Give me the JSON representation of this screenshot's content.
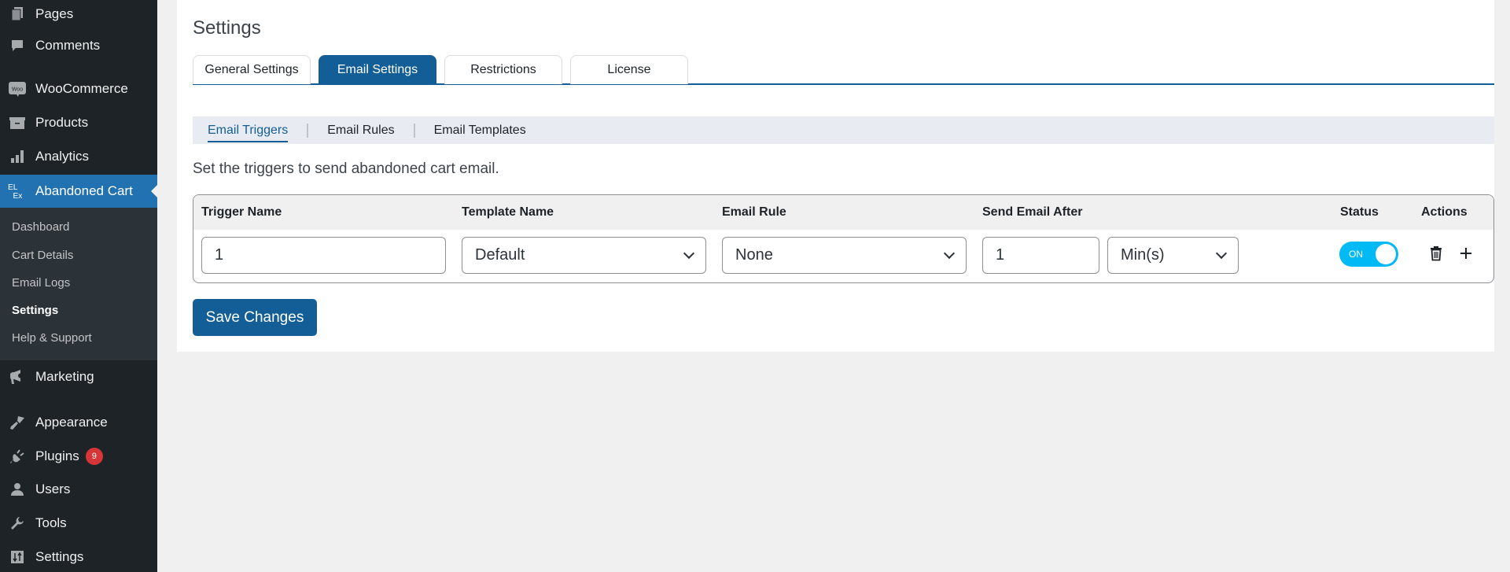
{
  "sidebar": {
    "items": [
      {
        "label": "Pages",
        "icon": "pages-icon"
      },
      {
        "label": "Comments",
        "icon": "comments-icon"
      },
      {
        "label": "WooCommerce",
        "icon": "woocommerce-icon",
        "icon_text": "Woo"
      },
      {
        "label": "Products",
        "icon": "products-icon"
      },
      {
        "label": "Analytics",
        "icon": "analytics-icon"
      },
      {
        "label": "Abandoned Cart",
        "icon": "elex-icon",
        "icon_text": "EL Ex",
        "active": true
      },
      {
        "label": "Marketing",
        "icon": "megaphone-icon"
      },
      {
        "label": "Appearance",
        "icon": "brush-icon"
      },
      {
        "label": "Plugins",
        "icon": "plugin-icon",
        "badge": "9"
      },
      {
        "label": "Users",
        "icon": "user-icon"
      },
      {
        "label": "Tools",
        "icon": "wrench-icon"
      },
      {
        "label": "Settings",
        "icon": "settings-icon"
      }
    ],
    "submenu": [
      {
        "label": "Dashboard"
      },
      {
        "label": "Cart Details"
      },
      {
        "label": "Email Logs"
      },
      {
        "label": "Settings",
        "current": true
      },
      {
        "label": "Help & Support"
      }
    ]
  },
  "page": {
    "title": "Settings",
    "tabs": [
      {
        "label": "General Settings"
      },
      {
        "label": "Email Settings",
        "active": true
      },
      {
        "label": "Restrictions"
      },
      {
        "label": "License"
      }
    ],
    "subnav": [
      {
        "label": "Email Triggers",
        "active": true
      },
      {
        "label": "Email Rules"
      },
      {
        "label": "Email Templates"
      }
    ],
    "description": "Set the triggers to send abandoned cart email."
  },
  "table": {
    "headers": {
      "trigger_name": "Trigger Name",
      "template_name": "Template Name",
      "email_rule": "Email Rule",
      "send_email_after": "Send Email After",
      "status": "Status",
      "actions": "Actions"
    },
    "rows": [
      {
        "trigger_name": "1",
        "template_name": "Default",
        "email_rule": "None",
        "send_after_value": "1",
        "send_after_unit": "Min(s)",
        "status": "ON"
      }
    ]
  },
  "buttons": {
    "save": "Save Changes"
  },
  "colors": {
    "primary": "#135e96",
    "sidebar_bg": "#1d2327",
    "sidebar_active": "#2271b1",
    "toggle_on": "#00b9f5",
    "badge": "#d63638"
  }
}
